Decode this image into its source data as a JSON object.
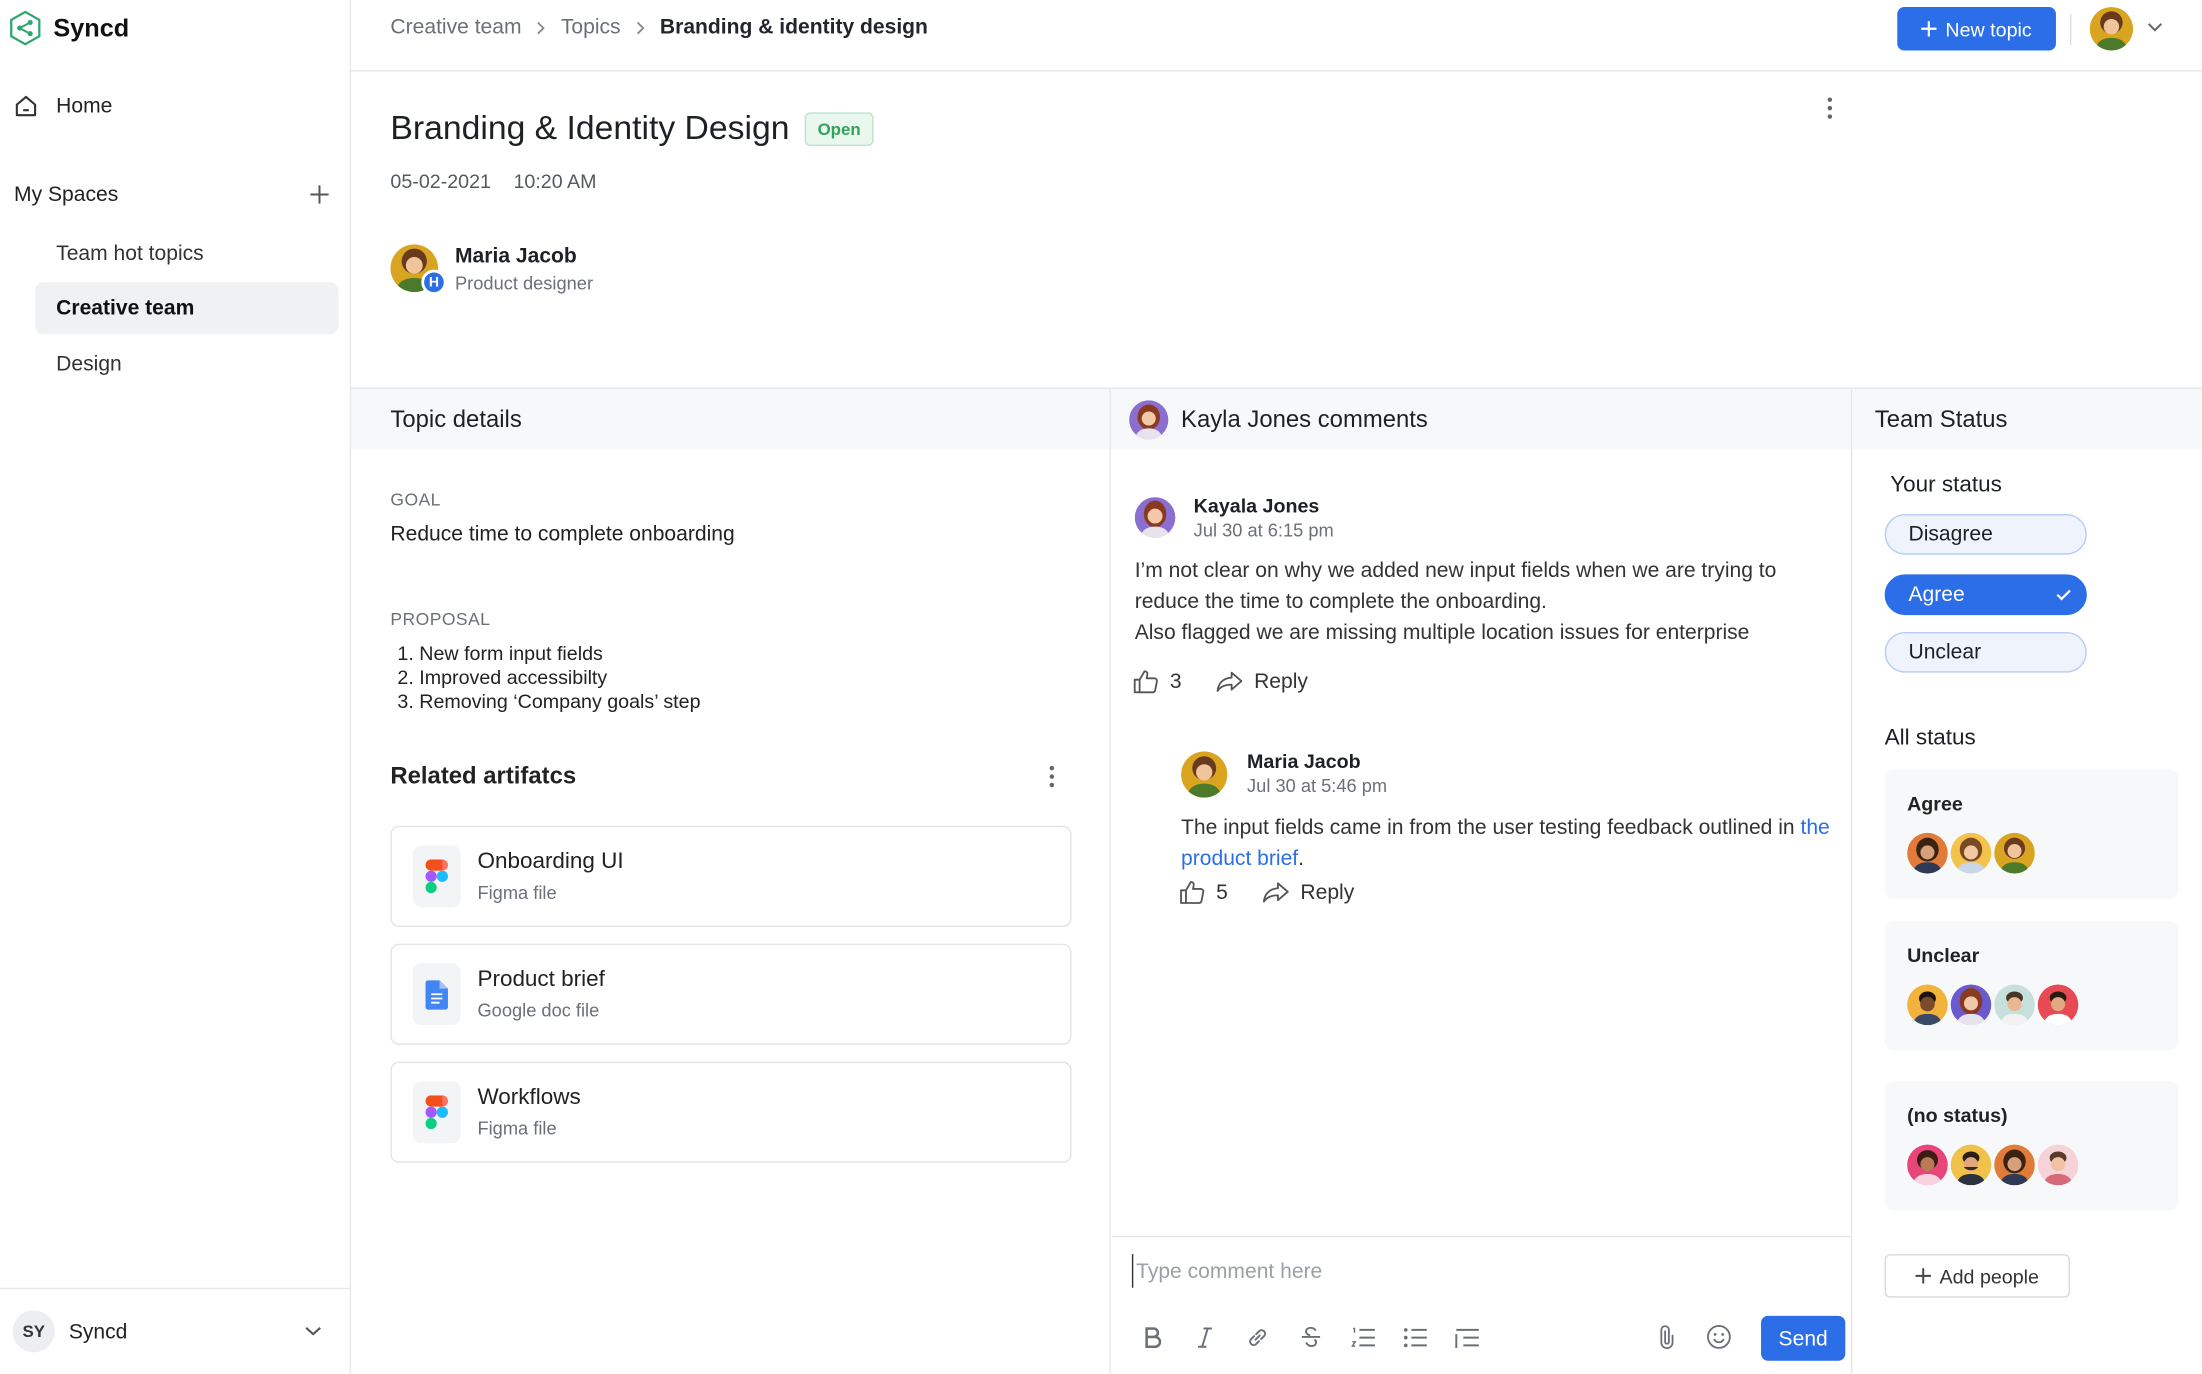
{
  "app": {
    "name": "Syncd",
    "brand_color": "#2b6ee8"
  },
  "sidebar": {
    "home_label": "Home",
    "spaces_heading": "My Spaces",
    "items": [
      {
        "label": "Team hot topics",
        "active": false
      },
      {
        "label": "Creative team",
        "active": true
      },
      {
        "label": "Design",
        "active": false
      }
    ],
    "workspace": {
      "initials": "SY",
      "name": "Syncd"
    }
  },
  "header": {
    "breadcrumb": [
      "Creative team",
      "Topics",
      "Branding & identity design"
    ],
    "new_topic_label": "New topic"
  },
  "topic": {
    "title": "Branding & Identity Design",
    "status_badge": "Open",
    "date": "05-02-2021",
    "time": "10:20 AM",
    "author": {
      "name": "Maria Jacob",
      "role": "Product designer",
      "badge": "H"
    }
  },
  "details": {
    "heading": "Topic details",
    "goal_label": "GOAL",
    "goal": "Reduce time to complete onboarding",
    "proposal_label": "PROPOSAL",
    "proposals": [
      "1. New form input fields",
      "2. Improved accessibilty",
      "3. Removing ‘Company goals’ step"
    ],
    "related_heading": "Related artifatcs",
    "artifacts": [
      {
        "title": "Onboarding UI",
        "subtitle": "Figma file",
        "icon": "figma-icon"
      },
      {
        "title": "Product brief",
        "subtitle": "Google doc file",
        "icon": "google-doc-icon"
      },
      {
        "title": "Workflows",
        "subtitle": "Figma file",
        "icon": "figma-icon"
      }
    ]
  },
  "comments": {
    "heading": "Kayla Jones comments",
    "items": [
      {
        "author": "Kayala Jones",
        "time": "Jul 30 at 6:15 pm",
        "lines": [
          "I’m not clear on why we added new input fields when we are trying to",
          "reduce the time to complete the onboarding.",
          "Also flagged we are missing multiple location issues for enterprise"
        ],
        "likes": "3",
        "reply_label": "Reply"
      },
      {
        "author": "Maria Jacob",
        "time": "Jul 30 at 5:46 pm",
        "text_before": "The input fields came in from the user testing feedback outlined in",
        "link_text": "the product brief",
        "text_after": ".",
        "likes": "5",
        "reply_label": "Reply"
      }
    ],
    "composer_placeholder": "Type comment here",
    "send_label": "Send"
  },
  "team_status": {
    "heading": "Team Status",
    "your_status_label": "Your status",
    "options": [
      {
        "label": "Disagree",
        "selected": false
      },
      {
        "label": "Agree",
        "selected": true
      },
      {
        "label": "Unclear",
        "selected": false
      }
    ],
    "all_status_label": "All status",
    "groups": [
      {
        "name": "Agree",
        "count": 3
      },
      {
        "name": "Unclear",
        "count": 4
      },
      {
        "name": "(no status)",
        "count": 4
      }
    ],
    "add_people_label": "Add people"
  }
}
